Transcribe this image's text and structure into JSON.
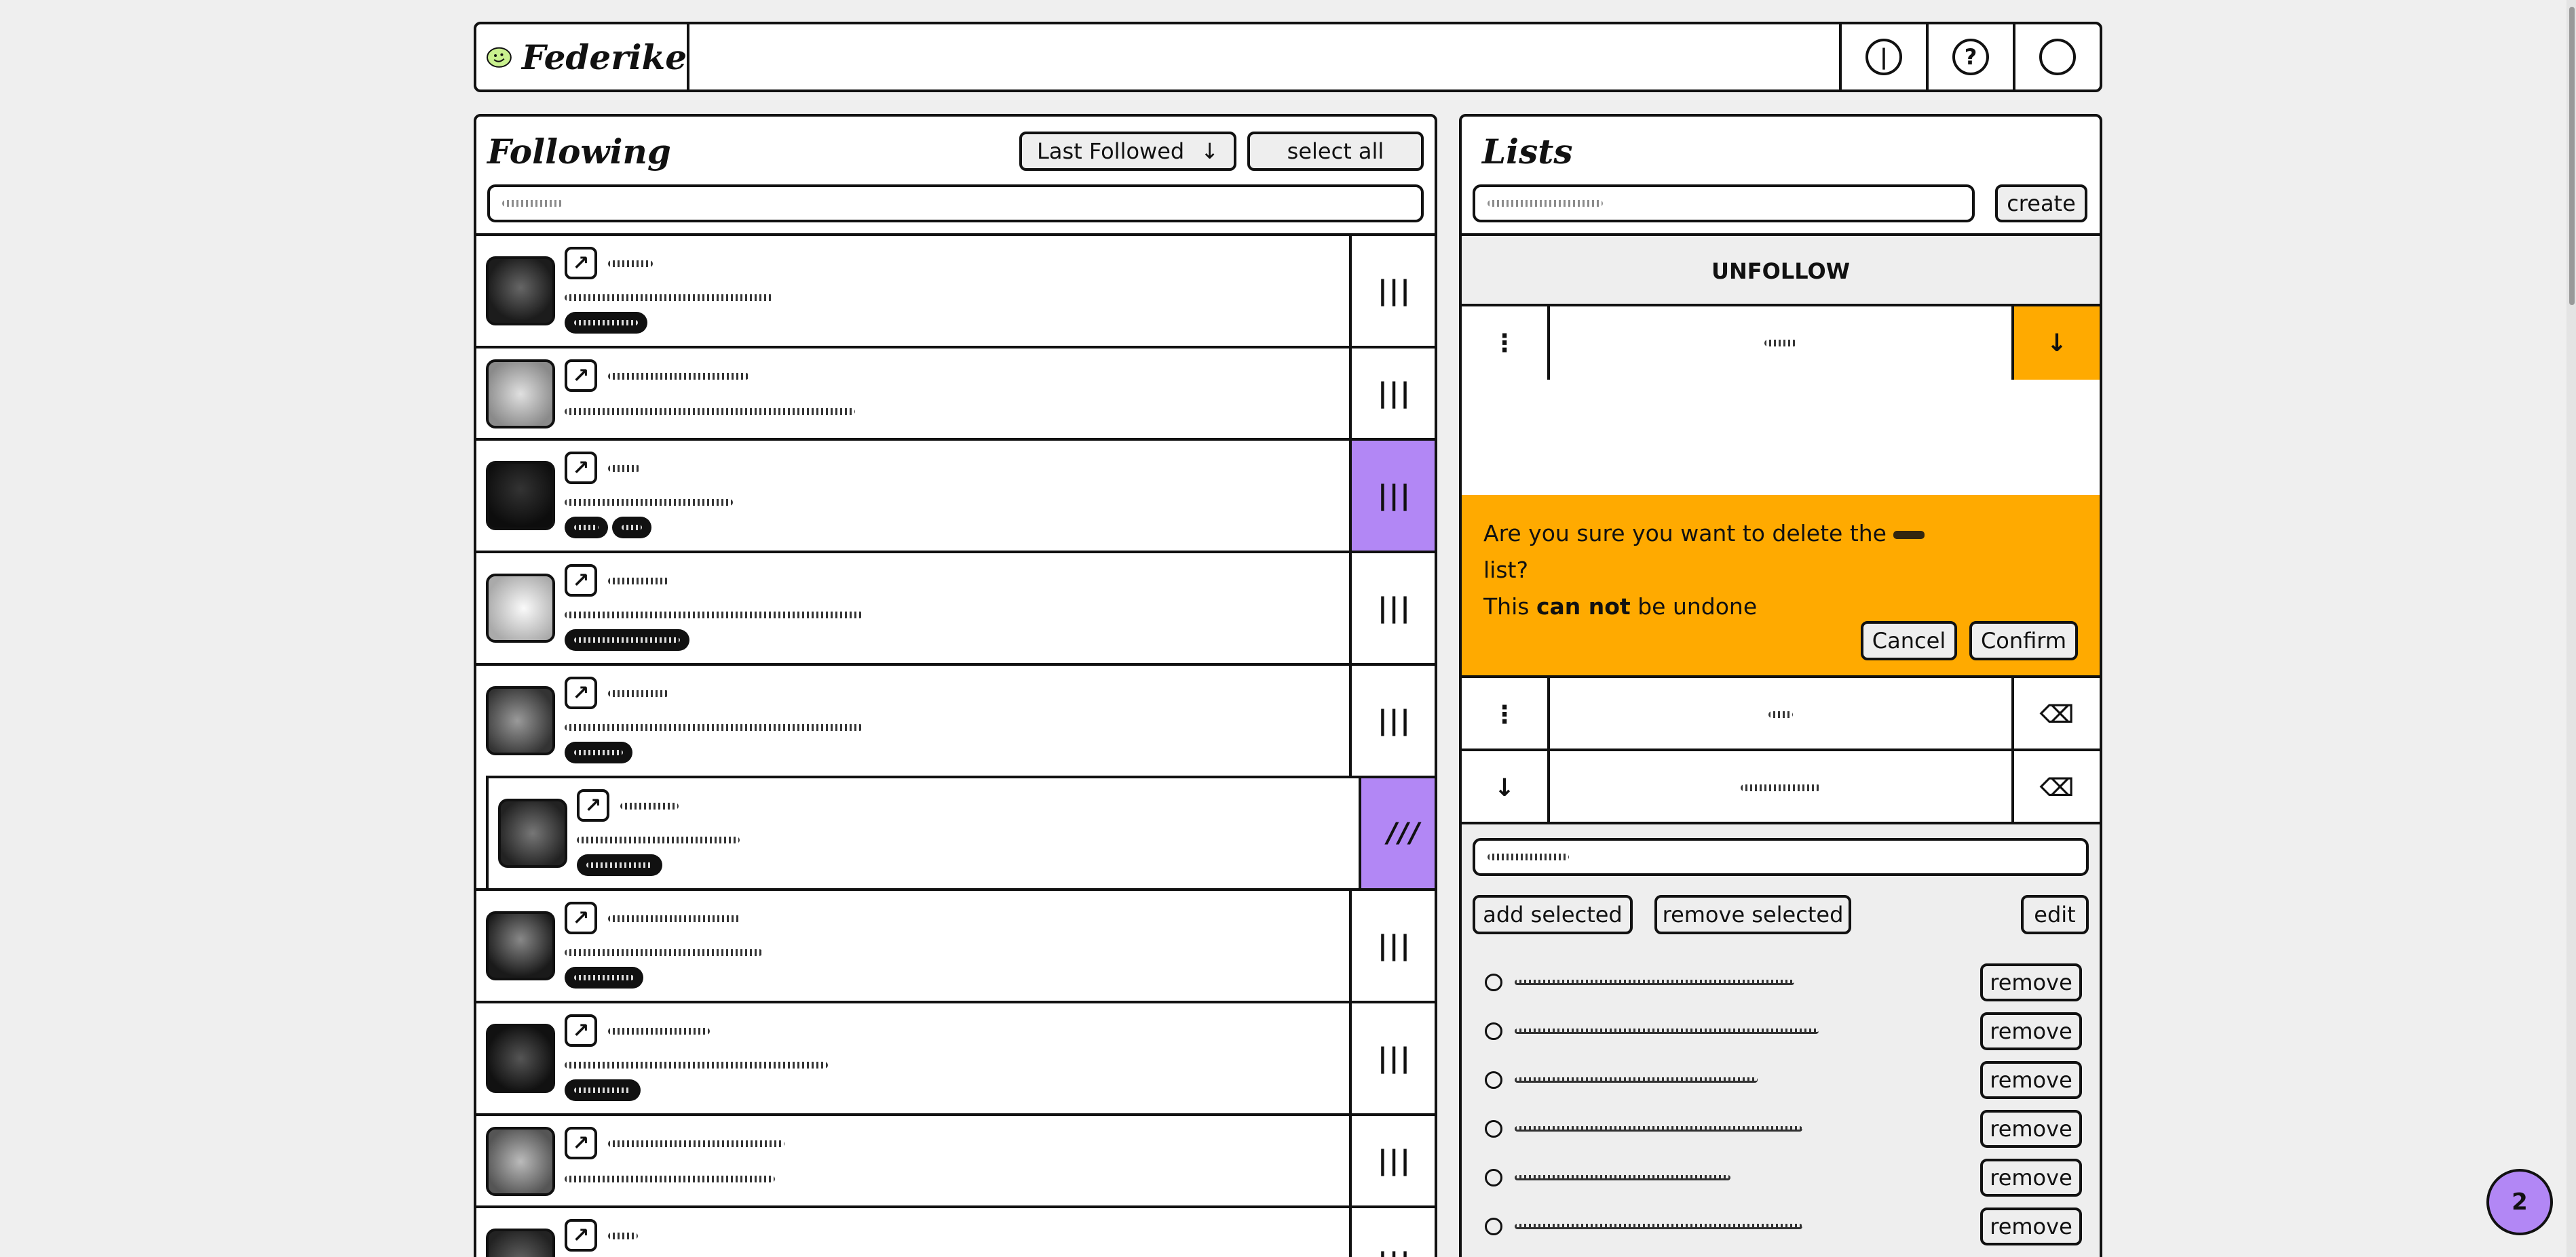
{
  "header": {
    "app_name": "Federike",
    "buttons": [
      {
        "icon": "info-icon",
        "glyph": "|"
      },
      {
        "icon": "help-icon",
        "glyph": "?"
      },
      {
        "icon": "profile-circle-icon",
        "glyph": ""
      }
    ]
  },
  "following": {
    "title": "Following",
    "sort_label": "Last Followed",
    "sort_arrow": "↓",
    "select_all": "select all",
    "grip_glyph": "|||",
    "drag_grip_glyph": "///"
  },
  "lists": {
    "title": "Lists",
    "create_label": "create",
    "unfollow_label": "UNFOLLOW",
    "menu_glyph": "⋮",
    "down_glyph": "↓",
    "delete_glyph": "⌫",
    "confirm": {
      "line1": "Are you sure you want to delete the",
      "line2": "list?",
      "line3a": "This",
      "line3b": "can not",
      "line3c": "be undone",
      "cancel": "Cancel",
      "confirm": "Confirm"
    },
    "add_selected": "add selected",
    "remove_selected": "remove selected",
    "edit": "edit",
    "remove_label": "remove"
  },
  "notification_count": "2",
  "colors": {
    "accent_purple": "#b287f5",
    "warning_orange": "#ffaa00",
    "background": "#efefef"
  }
}
